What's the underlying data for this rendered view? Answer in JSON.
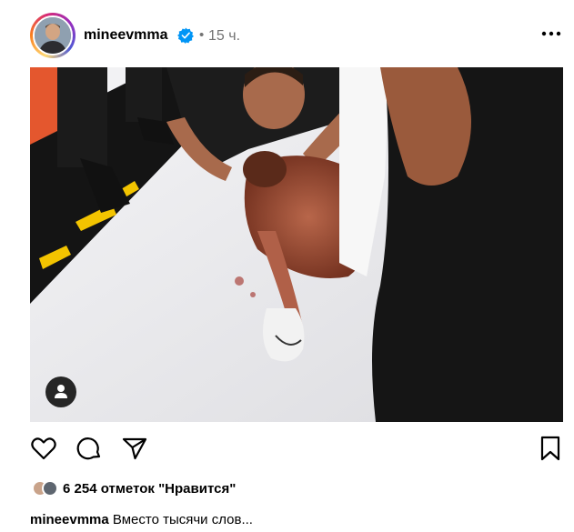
{
  "post": {
    "username": "mineevmma",
    "dot": "•",
    "time": "15 ч.",
    "avatar_icon": "user-avatar",
    "verified_icon": "verified-badge-icon",
    "more_icon": "more-options-icon"
  },
  "photo": {
    "user_tag_icon": "user-tag-icon"
  },
  "actions": {
    "like_icon": "heart-icon",
    "comment_icon": "comment-icon",
    "share_icon": "send-icon",
    "save_icon": "bookmark-icon"
  },
  "likes": {
    "text": "6 254 отметок \"Нравится\""
  },
  "caption": {
    "username": "mineevmma",
    "text": "Вместо тысячи слов..."
  },
  "colors": {
    "verified": "#0095f6",
    "secondary_text": "#737373",
    "octagon_red": "#d9261c",
    "octagon_yellow": "#f3c400"
  }
}
